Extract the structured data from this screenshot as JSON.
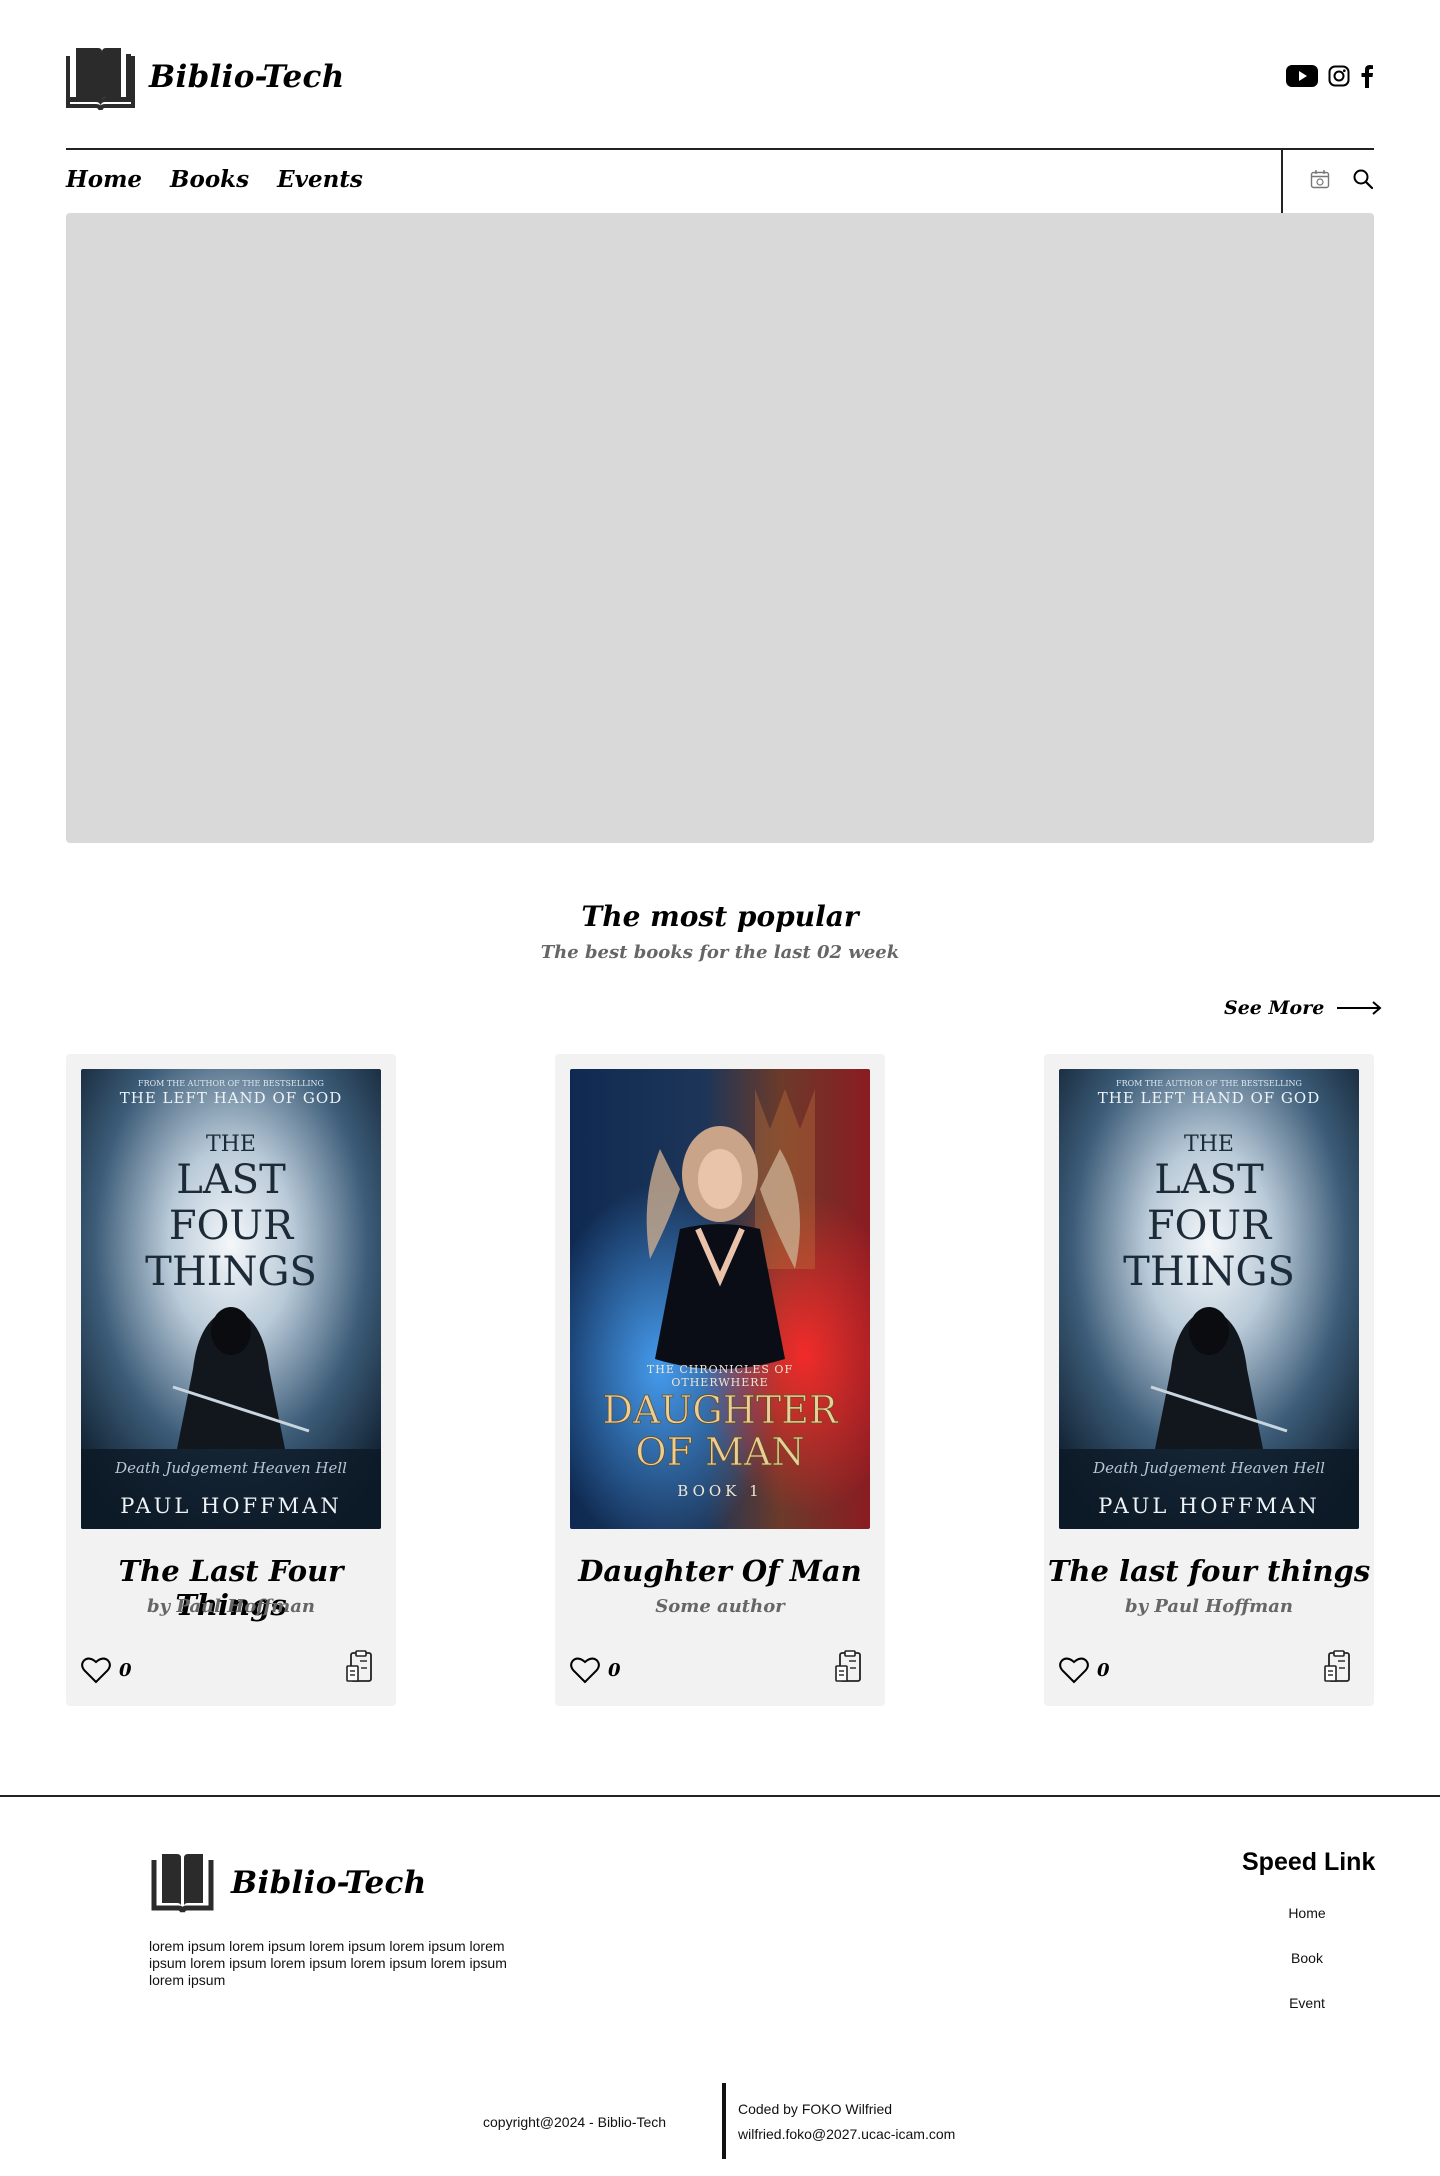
{
  "brand": {
    "name": "Biblio-Tech"
  },
  "header": {
    "socials": [
      "youtube-icon",
      "instagram-icon",
      "facebook-icon"
    ]
  },
  "nav": {
    "links": [
      "Home",
      "Books",
      "Events"
    ],
    "tools": [
      "calendar-icon",
      "search-icon"
    ]
  },
  "popular": {
    "title": "The most popular",
    "subtitle": "The best books for the last 02 week",
    "see_more": "See More"
  },
  "books": [
    {
      "title": "The Last Four Things",
      "author": "by Paul Hoffman",
      "likes": "0",
      "cover": {
        "top_small": "FROM THE AUTHOR OF THE BESTSELLING",
        "top": "THE LEFT HAND OF GOD",
        "the": "THE",
        "line1": "LAST",
        "line2": "FOUR",
        "line3": "THINGS",
        "tagline": "Death   Judgement   Heaven   Hell",
        "author": "PAUL HOFFMAN"
      }
    },
    {
      "title": "Daughter Of Man",
      "author": "Some author",
      "likes": "0",
      "cover": {
        "series1": "THE CHRONICLES OF",
        "series2": "OTHERWHERE",
        "line1": "DAUGHTER",
        "line2": "OF MAN",
        "book": "BOOK 1"
      }
    },
    {
      "title": "The last four things",
      "author": "by Paul Hoffman",
      "likes": "0",
      "cover": {
        "top_small": "FROM THE AUTHOR OF THE BESTSELLING",
        "top": "THE LEFT HAND OF GOD",
        "the": "THE",
        "line1": "LAST",
        "line2": "FOUR",
        "line3": "THINGS",
        "tagline": "Death   Judgement   Heaven   Hell",
        "author": "PAUL HOFFMAN"
      }
    }
  ],
  "footer": {
    "description": "lorem ipsum lorem ipsum lorem ipsum lorem ipsum lorem ipsum lorem ipsum lorem ipsum lorem ipsum lorem ipsum lorem ipsum",
    "speed_title": "Speed Link",
    "speed_links": [
      "Home",
      "Book",
      "Event"
    ],
    "copyright": "copyright@2024 - Biblio-Tech",
    "coded_by": "Coded by FOKO Wilfried",
    "email": "wilfried.foko@2027.ucac-icam.com"
  }
}
